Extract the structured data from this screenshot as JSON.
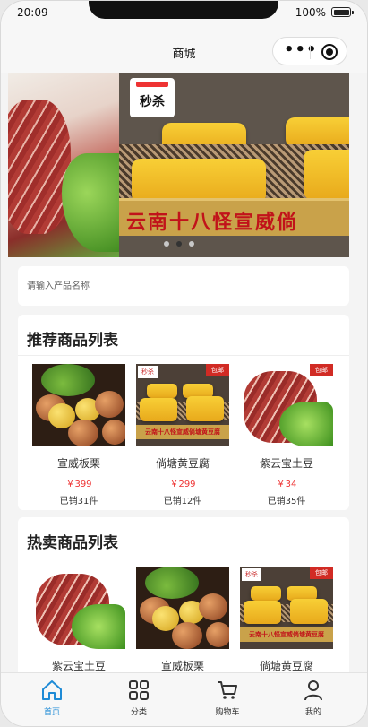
{
  "status_bar": {
    "time": "20:09",
    "battery": "100%"
  },
  "nav": {
    "title": "商城"
  },
  "banner": {
    "sale_tag": "秒杀",
    "caption": "云南十八怪宣威倘",
    "dots": 3,
    "active_dot": 1
  },
  "search": {
    "placeholder": "请输入产品名称"
  },
  "recommended": {
    "title": "推荐商品列表",
    "items": [
      {
        "name": "宣威板栗",
        "price": "￥399",
        "sold": "已销31件"
      },
      {
        "name": "倘塘黄豆腐",
        "price": "￥299",
        "sold": "已销12件"
      },
      {
        "name": "紫云宝土豆",
        "price": "￥34",
        "sold": "已销35件"
      }
    ]
  },
  "hot": {
    "title": "热卖商品列表",
    "items": [
      {
        "name": "紫云宝土豆"
      },
      {
        "name": "宣威板栗"
      },
      {
        "name": "倘塘黄豆腐"
      }
    ]
  },
  "product_images": {
    "tofu_tag": "秒杀",
    "tofu_corner": "包邮",
    "tofu_caption": "云南十八怪宣威倘塘黄豆腐",
    "ham_corner": "包邮"
  },
  "tabbar": {
    "items": [
      {
        "label": "首页",
        "icon": "home-icon",
        "active": true
      },
      {
        "label": "分类",
        "icon": "grid-icon",
        "active": false
      },
      {
        "label": "购物车",
        "icon": "cart-icon",
        "active": false
      },
      {
        "label": "我的",
        "icon": "user-icon",
        "active": false
      }
    ]
  },
  "colors": {
    "accent": "#1f8bd6",
    "price": "#ee3333",
    "background": "#f4f4f4"
  }
}
